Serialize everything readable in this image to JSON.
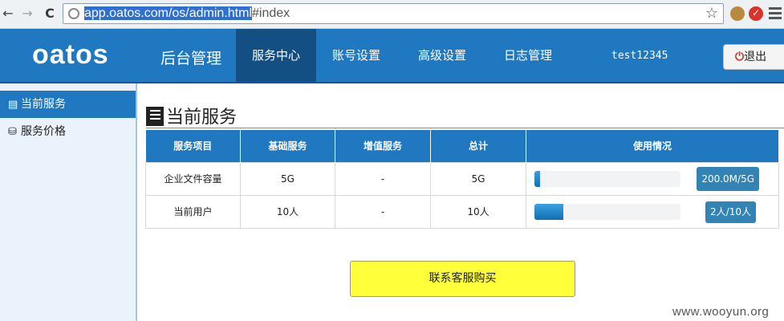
{
  "browser": {
    "url_selected": "app.oatos.com/os/admin.html",
    "url_rest": "#index",
    "back_glyph": "←",
    "forward_glyph": "→",
    "reload_glyph": "C",
    "star_glyph": "☆"
  },
  "header": {
    "logo": "oatos",
    "admin_title": "后台管理",
    "nav": [
      "服务中心",
      "账号设置",
      "高级设置",
      "日志管理"
    ],
    "username": "test12345",
    "logout_label": "退出",
    "logout_icon": "⏻"
  },
  "sidebar": {
    "items": [
      {
        "label": "当前服务",
        "icon": "▤",
        "active": true
      },
      {
        "label": "服务价格",
        "icon": "⛁",
        "active": false
      }
    ]
  },
  "main": {
    "title": "当前服务",
    "table": {
      "headers": [
        "服务项目",
        "基础服务",
        "增值服务",
        "总计",
        "使用情况"
      ],
      "rows": [
        {
          "item": "企业文件容量",
          "base": "5G",
          "extra": "-",
          "total": "5G",
          "usage_label": "200.0M/5G",
          "usage_fraction": 0.04
        },
        {
          "item": "当前用户",
          "base": "10人",
          "extra": "-",
          "total": "10人",
          "usage_label": "2人/10人",
          "usage_fraction": 0.2
        }
      ]
    },
    "buy_button": "联系客服购买"
  },
  "watermark": "www.wooyun.org",
  "colors": {
    "brand_blue": "#1f78c0",
    "nav_active": "#134f82",
    "buy_button": "#ffff3a"
  }
}
